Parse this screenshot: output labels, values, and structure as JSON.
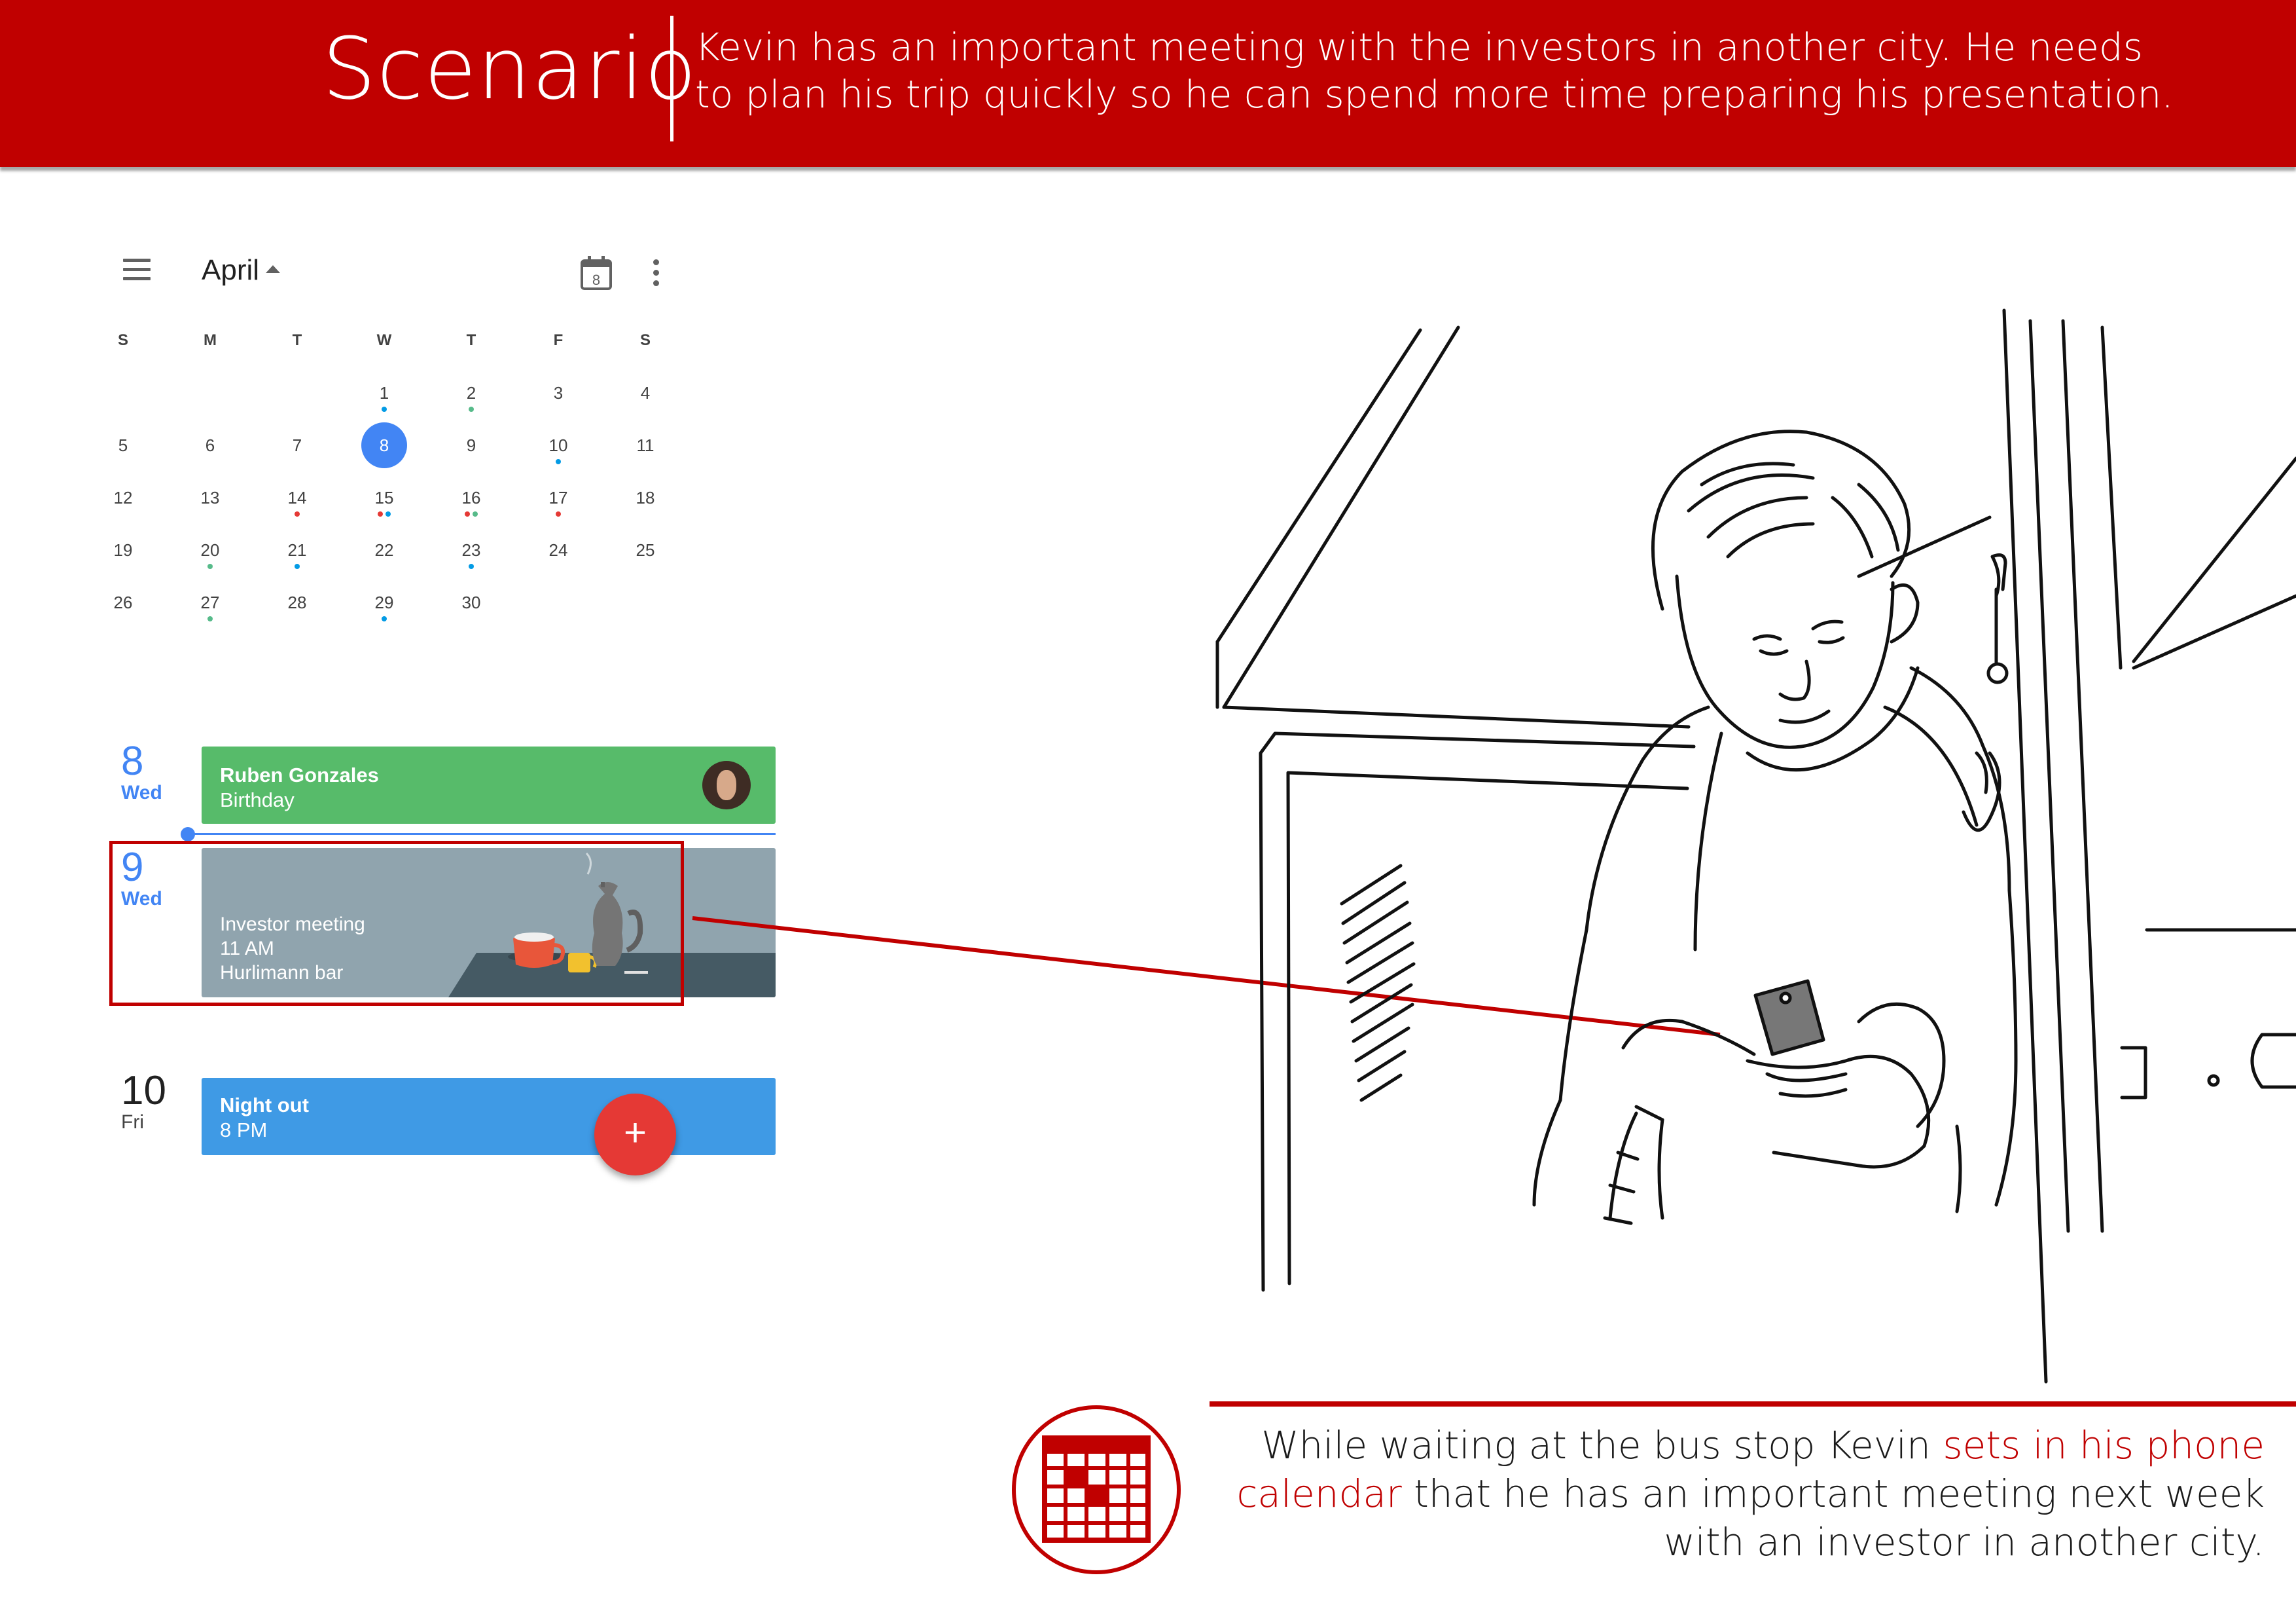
{
  "banner": {
    "title": "Scenario",
    "text_line1": "Kevin has an important meeting with the investors in another city.  He needs",
    "text_line2": "to plan his trip quickly so he can spend more time preparing his presentation."
  },
  "calendar": {
    "month": "April",
    "today_icon_label": "8",
    "weekdays": [
      "S",
      "M",
      "T",
      "W",
      "T",
      "F",
      "S"
    ],
    "weeks": [
      [
        "",
        "",
        "",
        "1",
        "2",
        "3",
        "4"
      ],
      [
        "5",
        "6",
        "7",
        "8",
        "9",
        "10",
        "11"
      ],
      [
        "12",
        "13",
        "14",
        "15",
        "16",
        "17",
        "18"
      ],
      [
        "19",
        "20",
        "21",
        "22",
        "23",
        "24",
        "25"
      ],
      [
        "26",
        "27",
        "28",
        "29",
        "30",
        "",
        ""
      ]
    ],
    "selected_day": "8",
    "event_dot_colors": {
      "green": "#57bb8a",
      "blue": "#039be5",
      "red": "#e53935"
    }
  },
  "agenda": {
    "day1": {
      "num": "8",
      "name": "Wed"
    },
    "day2": {
      "num": "9",
      "name": "Wed"
    },
    "day3": {
      "num": "10",
      "name": "Fri"
    },
    "event1": {
      "title": "Ruben Gonzales",
      "subtitle": "Birthday",
      "color": "#57bb6a"
    },
    "event2": {
      "title": "Investor meeting",
      "time": "11 AM",
      "place": "Hurlimann bar",
      "color": "#90a4ae"
    },
    "event3": {
      "title": "Night out",
      "time": "8 PM",
      "color": "#3f9ae5"
    },
    "fab_label": "+"
  },
  "caption": {
    "line1_a": "While waiting at the bus stop Kevin ",
    "line1_b": "sets in his phone",
    "line2_a": "calendar",
    "line2_b": " that he has an important meeting next week",
    "line3": "with an investor in another city."
  }
}
